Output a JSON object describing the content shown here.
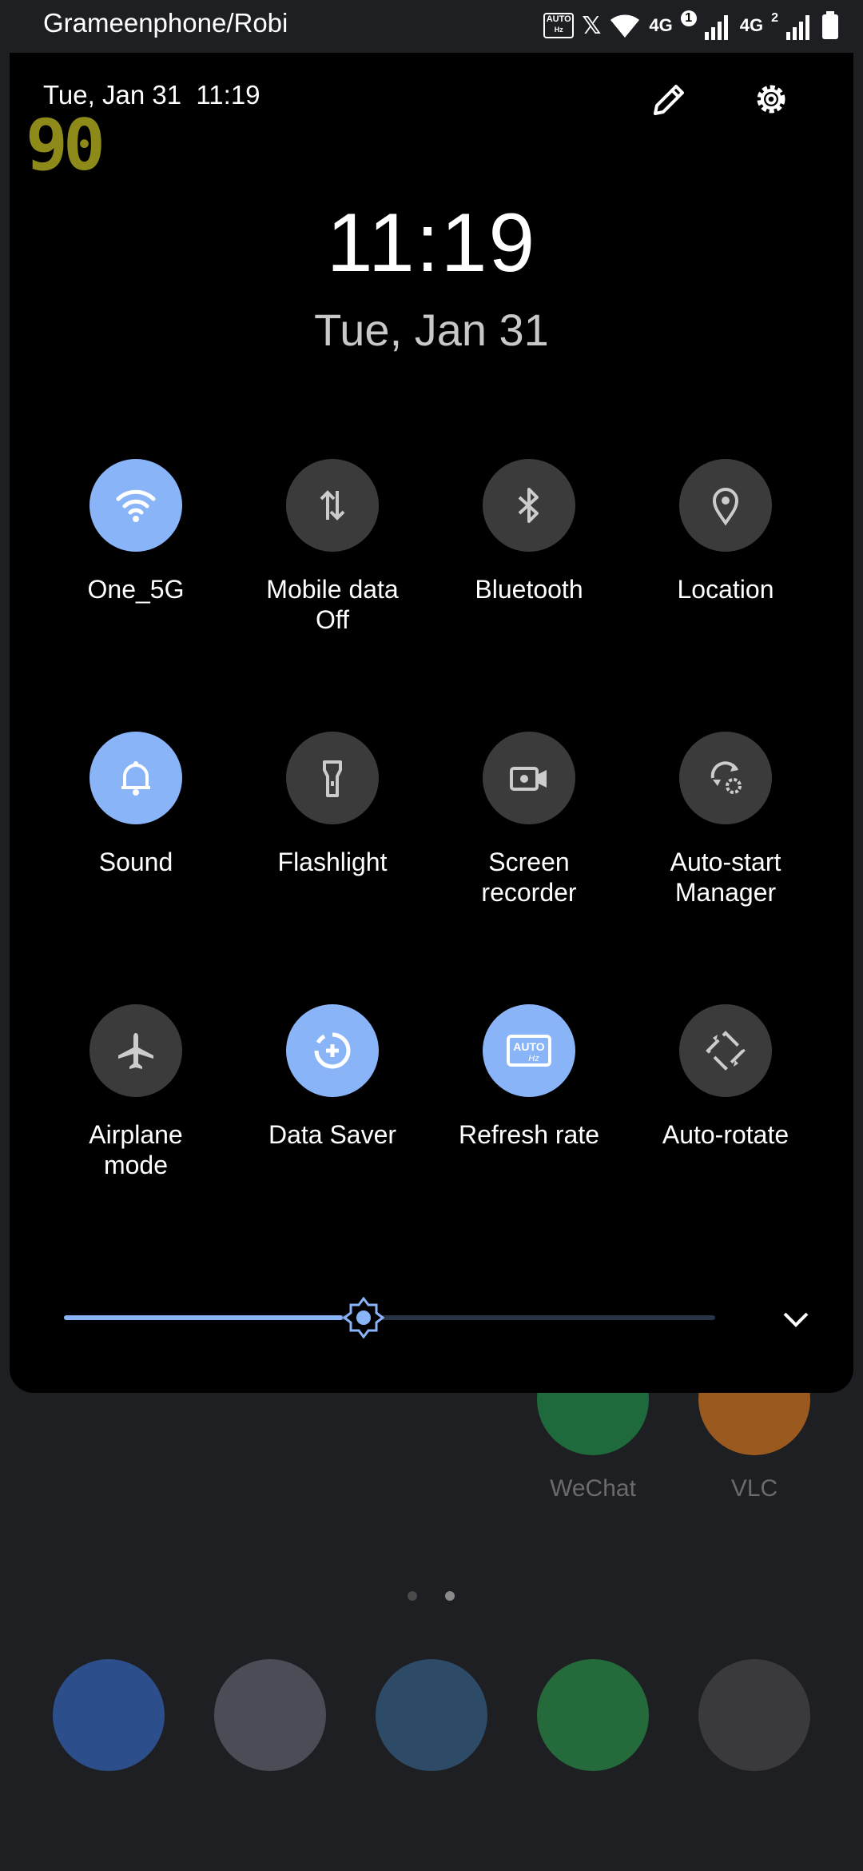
{
  "status_bar": {
    "carrier": "Grameenphone/Robi",
    "network_1": "4G",
    "sim_1_badge": "1",
    "network_2": "4G",
    "sim_2_badge": "2",
    "refresh_icon_text": "AUTO",
    "refresh_icon_subtext": "Hz"
  },
  "quick_settings": {
    "datetime": "Tue, Jan 31  11:19",
    "fps": "90",
    "clock": "11:19",
    "date": "Tue, Jan 31",
    "tiles": [
      {
        "label": "One_5G",
        "icon": "wifi-icon",
        "active": true
      },
      {
        "label": "Mobile data\nOff",
        "icon": "mobile-data-icon",
        "active": false
      },
      {
        "label": "Bluetooth",
        "icon": "bluetooth-icon",
        "active": false
      },
      {
        "label": "Location",
        "icon": "location-icon",
        "active": false
      },
      {
        "label": "Sound",
        "icon": "bell-icon",
        "active": true
      },
      {
        "label": "Flashlight",
        "icon": "flashlight-icon",
        "active": false
      },
      {
        "label": "Screen\nrecorder",
        "icon": "screen-recorder-icon",
        "active": false
      },
      {
        "label": "Auto-start\nManager",
        "icon": "auto-start-icon",
        "active": false
      },
      {
        "label": "Airplane\nmode",
        "icon": "airplane-icon",
        "active": false
      },
      {
        "label": "Data Saver",
        "icon": "data-saver-icon",
        "active": true
      },
      {
        "label": "Refresh rate",
        "icon": "refresh-rate-icon",
        "active": true
      },
      {
        "label": "Auto-rotate",
        "icon": "auto-rotate-icon",
        "active": false
      }
    ],
    "brightness": 0.46,
    "accent_color": "#8ab4f8"
  },
  "home_screen": {
    "apps": [
      {
        "label": "WeChat",
        "color": "#1f6a3c"
      },
      {
        "label": "VLC",
        "color": "#9a5a1f"
      }
    ],
    "dock": [
      {
        "name": "settings-app-icon",
        "color": "#2c4e8a"
      },
      {
        "name": "tasks-app-icon",
        "color": "#4a4d55"
      },
      {
        "name": "telegram-app-icon",
        "color": "#2d4a66"
      },
      {
        "name": "whatsapp-app-icon",
        "color": "#256a3a"
      },
      {
        "name": "youtube-app-icon",
        "color": "#3a3a3e"
      }
    ]
  }
}
